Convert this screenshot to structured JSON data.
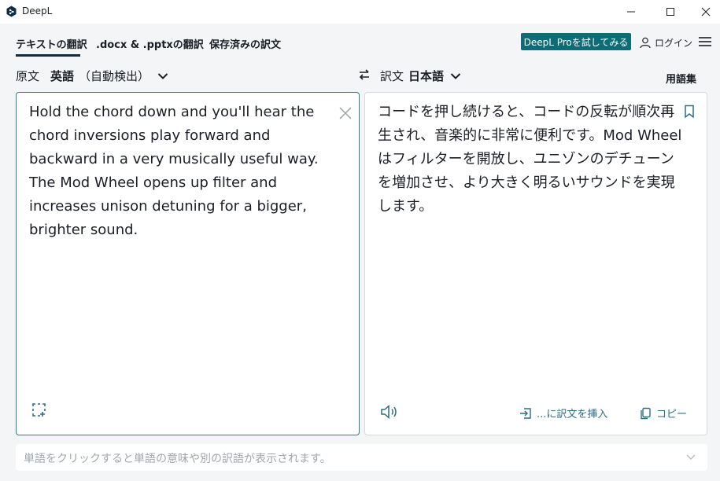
{
  "window": {
    "title": "DeepL",
    "icons": [
      "deepl-logo-icon",
      "minimize-icon",
      "maximize-icon",
      "close-icon"
    ]
  },
  "nav": {
    "tabs": [
      {
        "label": "テキストの翻訳",
        "active": true
      },
      {
        "label": ".docx & .pptxの翻訳",
        "active": false
      },
      {
        "label": "保存済みの訳文",
        "active": false
      }
    ],
    "pro_button": "DeepL Proを試してみる",
    "login_label": "ログイン",
    "colors": {
      "pro_button": "#0f6b75",
      "active_underline": "#0f2b46"
    }
  },
  "languages": {
    "source_label": "原文",
    "source_language": "英語",
    "source_detect": "（自動検出）",
    "target_label": "訳文",
    "target_language": "日本語",
    "glossary": "用語集"
  },
  "source": {
    "text": "Hold the chord down and you'll hear the chord inversions play forward and backward in a very musically useful way. The Mod Wheel opens up filter and increases unison detuning for a bigger, brighter sound."
  },
  "target": {
    "text": "コードを押し続けると、コードの反転が順次再生され、音楽的に非常に便利です。Mod Wheelはフィルターを開放し、ユニゾンのデチューンを増加させ、より大きく明るいサウンドを実現します。",
    "insert_label": "...に訳文を挿入",
    "copy_label": "コピー"
  },
  "dictionary": {
    "placeholder": "単語をクリックすると単語の意味や別の訳語が表示されます。"
  }
}
